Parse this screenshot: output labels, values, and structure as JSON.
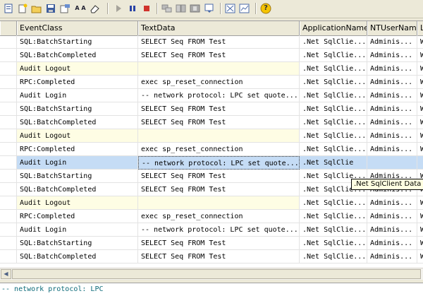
{
  "toolbar": {
    "icons": [
      "properties-icon",
      "new-trace-icon",
      "open-icon",
      "save-icon",
      "template-icon",
      "find-icon",
      "clear-icon",
      "start-icon",
      "pause-icon",
      "stop-icon",
      "properties-window-icon",
      "aggregate-icon",
      "autoscroll-icon",
      "perfmon-icon",
      "trace-properties-icon",
      "help-icon"
    ],
    "find_label": "A A",
    "help_label": "?"
  },
  "grid": {
    "columns": [
      "EventClass",
      "TextData",
      "ApplicationName",
      "NTUserName",
      "L"
    ],
    "rows": [
      {
        "event": "SQL:BatchStarting",
        "text": "SELECT Seq FROM Test",
        "app": ".Net SqlClie...",
        "user": "Adminis...",
        "l": "W"
      },
      {
        "event": "SQL:BatchCompleted",
        "text": "SELECT Seq FROM Test",
        "app": ".Net SqlClie...",
        "user": "Adminis...",
        "l": "W"
      },
      {
        "event": "Audit Logout",
        "text": "",
        "app": ".Net SqlClie...",
        "user": "Adminis...",
        "l": "W"
      },
      {
        "event": "RPC:Completed",
        "text": "exec sp_reset_connection",
        "app": ".Net SqlClie...",
        "user": "Adminis...",
        "l": "W"
      },
      {
        "event": "Audit Login",
        "text": "-- network protocol: LPC  set quote...",
        "app": ".Net SqlClie...",
        "user": "Adminis...",
        "l": "W"
      },
      {
        "event": "SQL:BatchStarting",
        "text": "SELECT Seq FROM Test",
        "app": ".Net SqlClie...",
        "user": "Adminis...",
        "l": "W"
      },
      {
        "event": "SQL:BatchCompleted",
        "text": "SELECT Seq FROM Test",
        "app": ".Net SqlClie...",
        "user": "Adminis...",
        "l": "W"
      },
      {
        "event": "Audit Logout",
        "text": "",
        "app": ".Net SqlClie...",
        "user": "Adminis...",
        "l": "W"
      },
      {
        "event": "RPC:Completed",
        "text": "exec sp_reset_connection",
        "app": ".Net SqlClie...",
        "user": "Adminis...",
        "l": "W"
      },
      {
        "event": "Audit Login",
        "text": "-- network protocol: LPC  set quote...",
        "app": ".Net SqlClie",
        "user": "",
        "l": ""
      },
      {
        "event": "SQL:BatchStarting",
        "text": "SELECT Seq FROM Test",
        "app": ".Net SqlClie...",
        "user": "Adminis...",
        "l": "W"
      },
      {
        "event": "SQL:BatchCompleted",
        "text": "SELECT Seq FROM Test",
        "app": ".Net SqlClie...",
        "user": "Adminis...",
        "l": "W"
      },
      {
        "event": "Audit Logout",
        "text": "",
        "app": ".Net SqlClie...",
        "user": "Adminis...",
        "l": "W"
      },
      {
        "event": "RPC:Completed",
        "text": "exec sp_reset_connection",
        "app": ".Net SqlClie...",
        "user": "Adminis...",
        "l": "W"
      },
      {
        "event": "Audit Login",
        "text": "-- network protocol: LPC  set quote...",
        "app": ".Net SqlClie...",
        "user": "Adminis...",
        "l": "W"
      },
      {
        "event": "SQL:BatchStarting",
        "text": "SELECT Seq FROM Test",
        "app": ".Net SqlClie...",
        "user": "Adminis...",
        "l": "W"
      },
      {
        "event": "SQL:BatchCompleted",
        "text": "SELECT Seq FROM Test",
        "app": ".Net SqlClie...",
        "user": "Adminis...",
        "l": "W"
      }
    ],
    "selected_row": 9,
    "tooltip": ".Net SqlClient Data"
  },
  "detail": {
    "text": "-- network protocol: LPC"
  },
  "colors": {
    "selection": "#c5dcf5",
    "audit_highlight": "#fefde4",
    "detail_text": "#0e6b7a"
  }
}
